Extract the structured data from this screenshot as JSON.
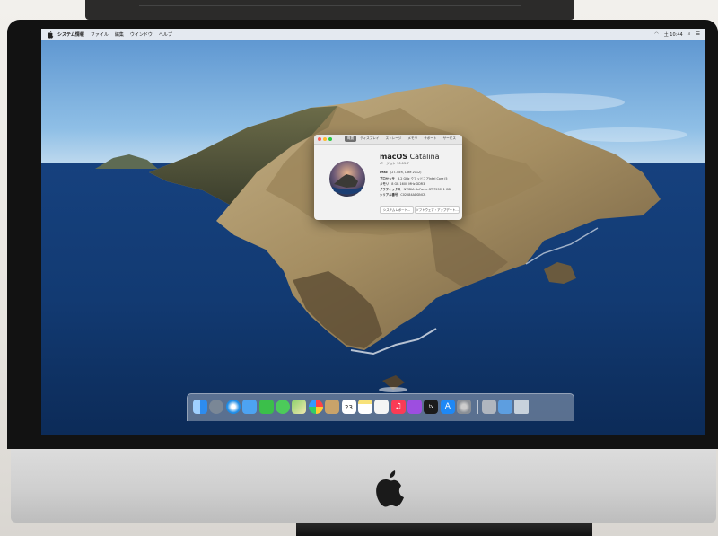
{
  "menubar": {
    "app_name": "システム情報",
    "items": [
      "ファイル",
      "編集",
      "ウインドウ",
      "ヘルプ"
    ],
    "clock": "土 10:44"
  },
  "about_window": {
    "tabs": [
      "概要",
      "ディスプレイ",
      "ストレージ",
      "メモリ",
      "サポート",
      "サービス"
    ],
    "active_tab": "概要",
    "os_name_bold": "macOS",
    "os_name_light": "Catalina",
    "os_version": "バージョン 10.15.7",
    "specs": [
      {
        "key": "iMac",
        "value": "(27-inch, Late 2012)"
      },
      {
        "key": "プロセッサ",
        "value": "3.2 GHz クアッドコアIntel Core i5"
      },
      {
        "key": "メモリ",
        "value": "8 GB 1600 MHz DDR3"
      },
      {
        "key": "グラフィックス",
        "value": "NVIDIA GeForce GT 755M 1 GB"
      },
      {
        "key": "シリアル番号",
        "value": "C02K84ADDNCR"
      }
    ],
    "buttons": [
      "システムレポート...",
      "ソフトウェア・アップデート..."
    ]
  },
  "dock": {
    "apps": [
      {
        "name": "finder",
        "color": "#2d8cf0"
      },
      {
        "name": "launchpad",
        "color": "#7a8796"
      },
      {
        "name": "safari",
        "color": "#1e8ce6"
      },
      {
        "name": "mail",
        "color": "#4da3f2"
      },
      {
        "name": "facetime",
        "color": "#3bbf4a"
      },
      {
        "name": "messages",
        "color": "#4ccb5a"
      },
      {
        "name": "maps",
        "color": "#67b35d"
      },
      {
        "name": "photos",
        "color": "#f3f3f3"
      },
      {
        "name": "contacts",
        "color": "#c9a36a"
      },
      {
        "name": "calendar",
        "color": "#ffffff"
      },
      {
        "name": "notes",
        "color": "#f8e27a"
      },
      {
        "name": "reminders",
        "color": "#f5f5f5"
      },
      {
        "name": "music",
        "color": "#fa3b55"
      },
      {
        "name": "podcasts",
        "color": "#9d4ee0"
      },
      {
        "name": "tv",
        "color": "#1b1b1b"
      },
      {
        "name": "app-store",
        "color": "#1e88f5"
      },
      {
        "name": "system-preferences",
        "color": "#8a8f96"
      }
    ],
    "extras": [
      {
        "name": "system-information",
        "color": "#b0b6bf"
      },
      {
        "name": "downloads",
        "color": "#5d9ee0"
      },
      {
        "name": "trash",
        "color": "#c8d2dc"
      }
    ],
    "calendar_day": "23"
  }
}
